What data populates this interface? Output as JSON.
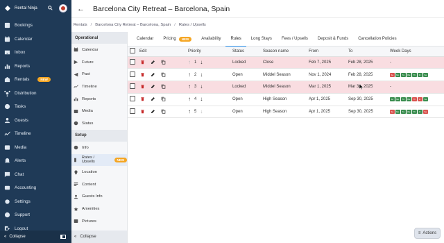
{
  "app": {
    "name": "Rental Ninja"
  },
  "left_nav": [
    {
      "id": "bookings",
      "label": "Bookings",
      "icon": "bookings-icon"
    },
    {
      "id": "calendar",
      "label": "Calendar",
      "icon": "calendar-icon"
    },
    {
      "id": "inbox",
      "label": "Inbox",
      "icon": "inbox-icon"
    },
    {
      "id": "reports",
      "label": "Reports",
      "icon": "reports-icon"
    },
    {
      "id": "rentals",
      "label": "Rentals",
      "icon": "rentals-icon",
      "badge": "NEW"
    },
    {
      "id": "distribution",
      "label": "Distribution",
      "icon": "distribution-icon"
    },
    {
      "id": "tasks",
      "label": "Tasks",
      "icon": "tasks-icon"
    },
    {
      "id": "guests",
      "label": "Guests",
      "icon": "guests-icon"
    },
    {
      "id": "timeline",
      "label": "Timeline",
      "icon": "timeline-icon"
    },
    {
      "id": "media",
      "label": "Media",
      "icon": "media-icon"
    },
    {
      "id": "alerts",
      "label": "Alerts",
      "icon": "alerts-icon"
    },
    {
      "id": "chat",
      "label": "Chat",
      "icon": "chat-icon"
    },
    {
      "id": "accounting",
      "label": "Accounting",
      "icon": "accounting-icon"
    },
    {
      "id": "settings",
      "label": "Settings",
      "icon": "settings-icon"
    },
    {
      "id": "support",
      "label": "Support",
      "icon": "support-icon"
    },
    {
      "id": "logout",
      "label": "Logout",
      "icon": "logout-icon"
    }
  ],
  "left_collapse_label": "Collapse",
  "page_title": "Barcelona City Retreat – Barcelona, Spain",
  "breadcrumb": [
    "Rentals",
    "Barcelona City Retreat – Barcelona, Spain",
    "Rates / Upsells"
  ],
  "sub_nav": {
    "operational_title": "Operational",
    "operational": [
      {
        "label": "Calendar",
        "icon": "calendar-icon"
      },
      {
        "label": "Future",
        "icon": "future-icon"
      },
      {
        "label": "Past",
        "icon": "past-icon"
      },
      {
        "label": "Timeline",
        "icon": "timeline-icon"
      },
      {
        "label": "Reports",
        "icon": "reports-icon"
      },
      {
        "label": "Media",
        "icon": "media-icon"
      },
      {
        "label": "Status",
        "icon": "status-icon"
      }
    ],
    "setup_title": "Setup",
    "setup": [
      {
        "label": "Info",
        "icon": "info-icon"
      },
      {
        "label": "Rates / Upsells",
        "icon": "rates-icon",
        "badge": "NEW",
        "active": true
      },
      {
        "label": "Location",
        "icon": "location-icon"
      },
      {
        "label": "Content",
        "icon": "content-icon"
      },
      {
        "label": "Guests Info",
        "icon": "guests-info-icon"
      },
      {
        "label": "Amenities",
        "icon": "amenities-icon"
      },
      {
        "label": "Pictures",
        "icon": "pictures-icon"
      }
    ],
    "collapse_label": "Collapse"
  },
  "tabs": [
    {
      "label": "Calendar"
    },
    {
      "label": "Pricing",
      "badge": "NEW"
    },
    {
      "label": "Availability"
    },
    {
      "label": "Rules",
      "active": true
    },
    {
      "label": "Long Stays"
    },
    {
      "label": "Fees / Upsells"
    },
    {
      "label": "Deposit & Funds"
    },
    {
      "label": "Cancellation Policies"
    }
  ],
  "table": {
    "headers": [
      "Edit",
      "Priority",
      "Status",
      "Season name",
      "From",
      "To",
      "Week Days"
    ],
    "rows": [
      {
        "priority": "1",
        "status": "Locked",
        "season": "Close",
        "from": "Feb 7, 2025",
        "to": "Feb 28, 2025",
        "weekdays": "-",
        "locked": true
      },
      {
        "priority": "2",
        "status": "Open",
        "season": "Middel Season",
        "from": "Nov 1, 2024",
        "to": "Feb 28, 2025",
        "weekdays": "days",
        "locked": false
      },
      {
        "priority": "3",
        "status": "Locked",
        "season": "Middel Season",
        "from": "Mar 1, 2025",
        "to": "Mar 31, 2025",
        "weekdays": "-",
        "locked": true
      },
      {
        "priority": "4",
        "status": "Open",
        "season": "High Season",
        "from": "Apr 1, 2025",
        "to": "Sep 30, 2025",
        "weekdays": "days",
        "locked": false
      },
      {
        "priority": "5",
        "status": "Open",
        "season": "High Season",
        "from": "Apr 1, 2025",
        "to": "Sep 30, 2025",
        "weekdays": "days",
        "locked": false
      }
    ]
  },
  "weekday_labels": [
    "Su",
    "Mo",
    "Tu",
    "We",
    "Th",
    "Fr",
    "Sa"
  ],
  "weekday_colors": {
    "row2": [
      "#d9534f",
      "#3a8d4f",
      "#3a8d4f",
      "#3a8d4f",
      "#3a8d4f",
      "#3a8d4f",
      "#3a8d4f"
    ],
    "row4": [
      "#3a8d4f",
      "#3a8d4f",
      "#3a8d4f",
      "#3a8d4f",
      "#d9534f",
      "#d9534f",
      "#3a8d4f"
    ],
    "row5": [
      "#d9534f",
      "#3a8d4f",
      "#3a8d4f",
      "#3a8d4f",
      "#3a8d4f",
      "#3a8d4f",
      "#d9534f"
    ]
  },
  "colors": {
    "nav_bg": "#1f3a57",
    "accent": "#1e88e5",
    "locked_row": "#f9dde1",
    "new_badge": "#f5a623"
  },
  "actions_label": "Actions"
}
